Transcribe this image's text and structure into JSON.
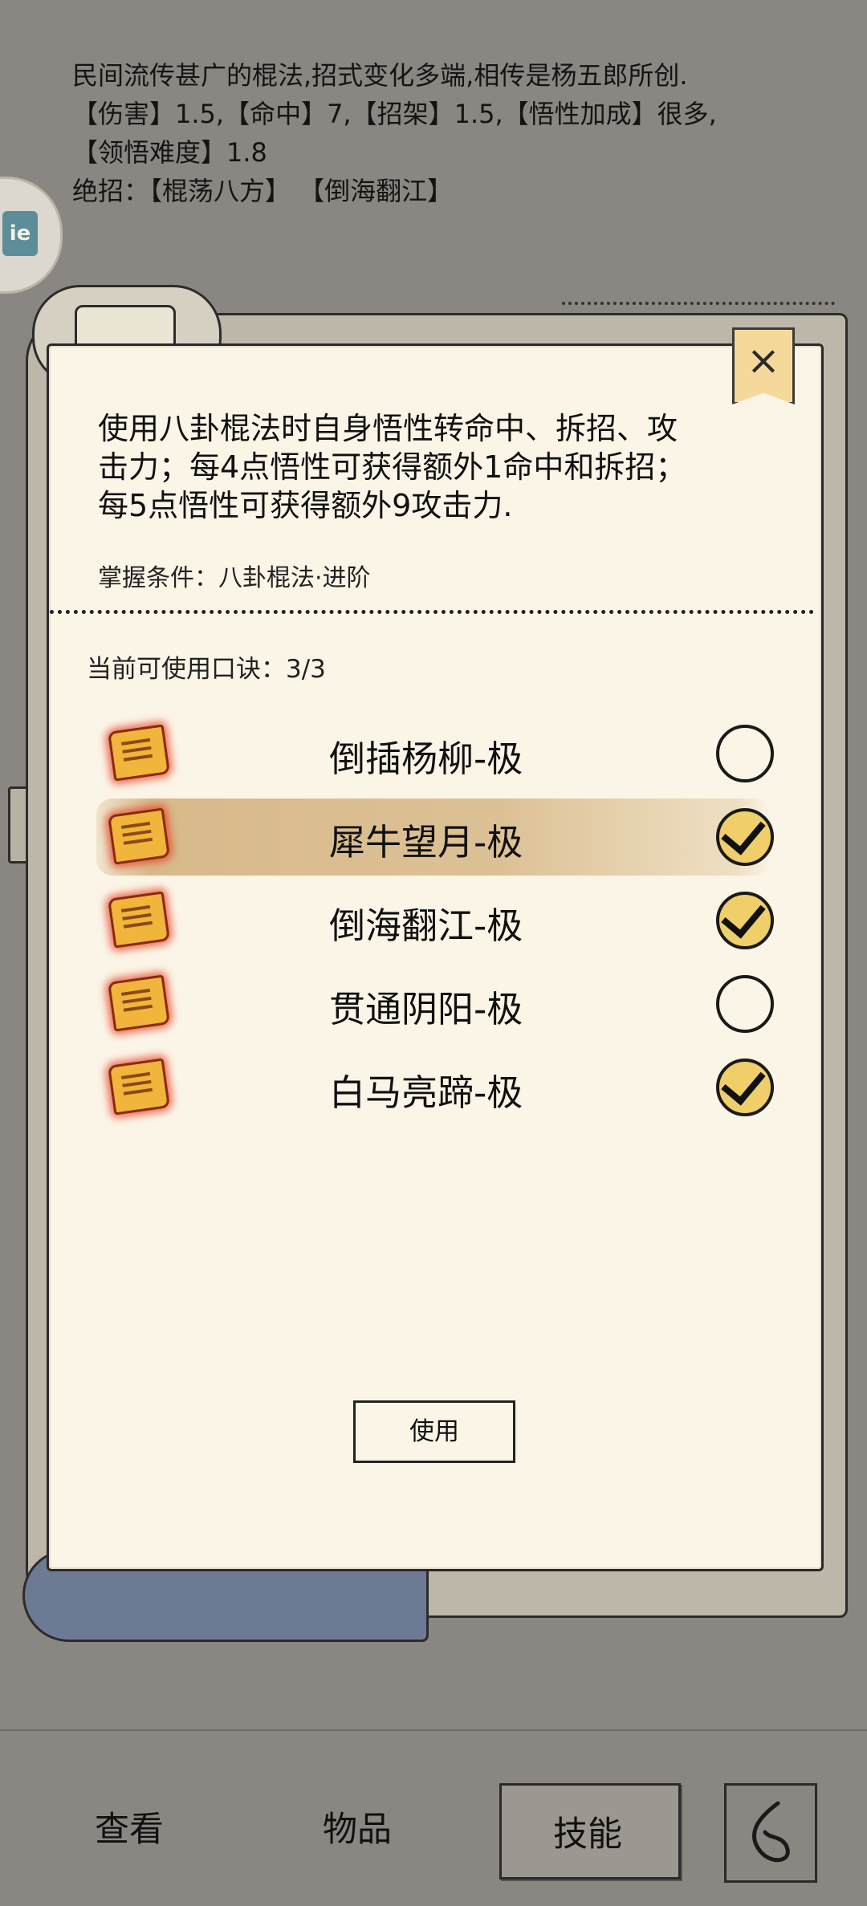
{
  "background_info": {
    "line1": "民间流传甚广的棍法,招式变化多端,相传是杨五郎所创.",
    "line2": "【伤害】1.5,【命中】7,【招架】1.5,【悟性加成】很多,",
    "line3": "【领悟难度】1.8",
    "line4": "绝招：【棍荡八方】 【倒海翻江】"
  },
  "side_button": {
    "label": "ie"
  },
  "panel": {
    "close_label": "×",
    "description": [
      "使用八卦棍法时自身悟性转命中、拆招、攻",
      "击力；每4点悟性可获得额外1命中和拆招；",
      "每5点悟性可获得额外9攻击力."
    ],
    "condition": "掌握条件：八卦棍法·进阶",
    "available": "当前可使用口诀：3/3",
    "items": [
      {
        "label": "倒插杨柳-极",
        "checked": false
      },
      {
        "label": "犀牛望月-极",
        "checked": true
      },
      {
        "label": "倒海翻江-极",
        "checked": true
      },
      {
        "label": "贯通阴阳-极",
        "checked": false
      },
      {
        "label": "白马亮蹄-极",
        "checked": true
      }
    ],
    "use_button": "使用"
  },
  "bottom_nav": {
    "view": "查看",
    "items": "物品",
    "skills": "技能"
  }
}
